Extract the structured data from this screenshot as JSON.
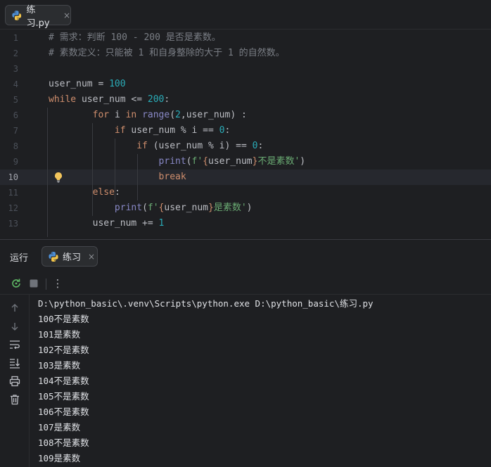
{
  "editor_tab": {
    "label": "练习.py",
    "close": "×"
  },
  "editor": {
    "line_numbers": [
      "1",
      "2",
      "3",
      "4",
      "5",
      "6",
      "7",
      "8",
      "9",
      "10",
      "11",
      "12",
      "13"
    ],
    "current_line_index": 9,
    "lines": [
      [
        {
          "c": "cmt",
          "t": "# 需求：判断 100 - 200 是否是素数。"
        }
      ],
      [
        {
          "c": "cmt",
          "t": "# 素数定义：只能被 1 和自身整除的大于 1 的自然数。"
        }
      ],
      [],
      [
        {
          "c": "idn",
          "t": "user_num = "
        },
        {
          "c": "num",
          "t": "100"
        }
      ],
      [
        {
          "c": "kw",
          "t": "while "
        },
        {
          "c": "idn",
          "t": "user_num <= "
        },
        {
          "c": "num",
          "t": "200"
        },
        {
          "c": "idn",
          "t": ":"
        }
      ],
      [
        {
          "c": "idn",
          "t": "        "
        },
        {
          "c": "kw",
          "t": "for "
        },
        {
          "c": "idn",
          "t": "i "
        },
        {
          "c": "kw",
          "t": "in "
        },
        {
          "c": "fn",
          "t": "range"
        },
        {
          "c": "idn",
          "t": "("
        },
        {
          "c": "num",
          "t": "2"
        },
        {
          "c": "idn",
          "t": ",user_num) :"
        }
      ],
      [
        {
          "c": "idn",
          "t": "            "
        },
        {
          "c": "kw",
          "t": "if "
        },
        {
          "c": "idn",
          "t": "user_num % i == "
        },
        {
          "c": "num",
          "t": "0"
        },
        {
          "c": "idn",
          "t": ":"
        }
      ],
      [
        {
          "c": "idn",
          "t": "                "
        },
        {
          "c": "kw",
          "t": "if "
        },
        {
          "c": "idn",
          "t": "(user_num % i) == "
        },
        {
          "c": "num",
          "t": "0"
        },
        {
          "c": "idn",
          "t": ":"
        }
      ],
      [
        {
          "c": "idn",
          "t": "                    "
        },
        {
          "c": "fn",
          "t": "print"
        },
        {
          "c": "idn",
          "t": "("
        },
        {
          "c": "str",
          "t": "f'"
        },
        {
          "c": "brace",
          "t": "{"
        },
        {
          "c": "idn",
          "t": "user_num"
        },
        {
          "c": "brace",
          "t": "}"
        },
        {
          "c": "str",
          "t": "不是素数'"
        },
        {
          "c": "idn",
          "t": ")"
        }
      ],
      [
        {
          "c": "idn",
          "t": "                    "
        },
        {
          "c": "kw",
          "t": "break"
        }
      ],
      [
        {
          "c": "idn",
          "t": "        "
        },
        {
          "c": "kw",
          "t": "else"
        },
        {
          "c": "idn",
          "t": ":"
        }
      ],
      [
        {
          "c": "idn",
          "t": "            "
        },
        {
          "c": "fn",
          "t": "print"
        },
        {
          "c": "idn",
          "t": "("
        },
        {
          "c": "str",
          "t": "f'"
        },
        {
          "c": "brace",
          "t": "{"
        },
        {
          "c": "idn",
          "t": "user_num"
        },
        {
          "c": "brace",
          "t": "}"
        },
        {
          "c": "str",
          "t": "是素数'"
        },
        {
          "c": "idn",
          "t": ")"
        }
      ],
      [
        {
          "c": "idn",
          "t": "        user_num += "
        },
        {
          "c": "num",
          "t": "1"
        }
      ]
    ]
  },
  "run_panel": {
    "title": "运行",
    "tab_label": "练习",
    "tab_close": "×",
    "more": "⋮",
    "console_lines": [
      "D:\\python_basic\\.venv\\Scripts\\python.exe D:\\python_basic\\练习.py",
      "100不是素数",
      "101是素数",
      "102不是素数",
      "103是素数",
      "104不是素数",
      "105不是素数",
      "106不是素数",
      "107是素数",
      "108不是素数",
      "109是素数"
    ]
  },
  "colors": {
    "keyword": "#cf8e6d",
    "number": "#2aacb8",
    "comment": "#7a7e85",
    "string": "#6aab73",
    "builtin": "#8888c6",
    "rerun": "#5fb865"
  }
}
